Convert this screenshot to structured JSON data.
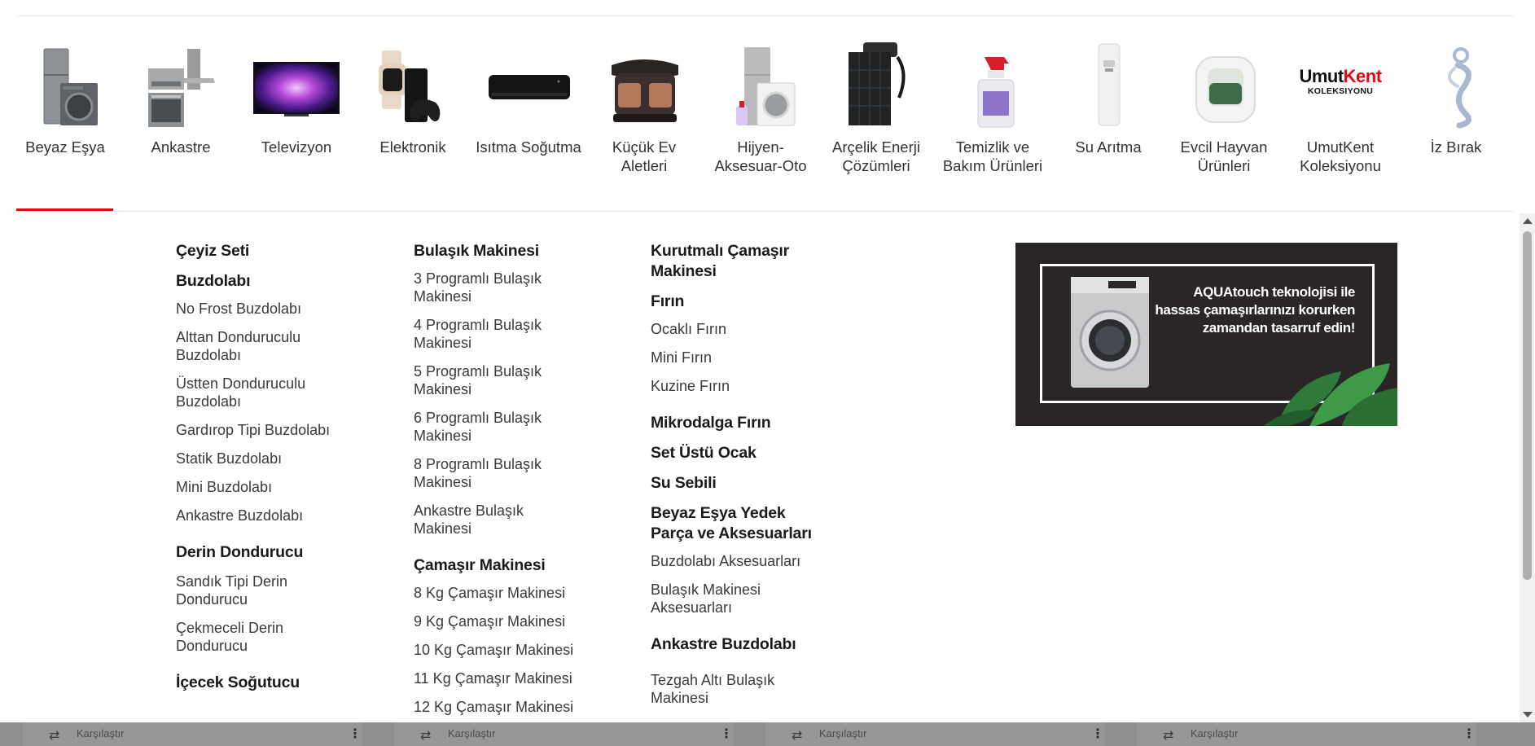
{
  "categories": [
    {
      "label": "Beyaz Eşya",
      "icon": "fridge-washer-icon"
    },
    {
      "label": "Ankastre",
      "icon": "built-in-oven-icon"
    },
    {
      "label": "Televizyon",
      "icon": "tv-icon"
    },
    {
      "label": "Elektronik",
      "icon": "watch-console-icon"
    },
    {
      "label": "Isıtma Soğutma",
      "icon": "air-conditioner-icon"
    },
    {
      "label": "Küçük Ev Aletleri",
      "icon": "coffee-machine-icon"
    },
    {
      "label": "Hijyen-Aksesuar-Oto",
      "icon": "hygiene-products-icon"
    },
    {
      "label": "Arçelik Enerji Çözümleri",
      "icon": "solar-panel-charger-icon"
    },
    {
      "label": "Temizlik ve Bakım Ürünleri",
      "icon": "spray-bottle-icon"
    },
    {
      "label": "Su Arıtma",
      "icon": "water-purifier-icon"
    },
    {
      "label": "Evcil Hayvan Ürünleri",
      "icon": "pet-litter-box-icon"
    },
    {
      "label": "UmutKent Koleksiyonu",
      "icon": "umutkent-logo"
    },
    {
      "label": "İz Bırak",
      "icon": "iz-birak-logo"
    }
  ],
  "umutkent_logo": {
    "umut": "Umut",
    "kent": "Kent",
    "sub": "KOLEKSIYONU"
  },
  "menu": {
    "col1": {
      "h1": "Çeyiz Seti",
      "h2": "Buzdolabı",
      "buzdolabi": [
        "No Frost Buzdolabı",
        "Alttan Donduruculu Buzdolabı",
        "Üstten Donduruculu Buzdolabı",
        "Gardırop Tipi Buzdolabı",
        "Statik Buzdolabı",
        "Mini Buzdolabı",
        "Ankastre Buzdolabı"
      ],
      "h3": "Derin Dondurucu",
      "derin": [
        "Sandık Tipi Derin Dondurucu",
        "Çekmeceli Derin Dondurucu"
      ],
      "h4": "İçecek Soğutucu"
    },
    "col2": {
      "h1": "Bulaşık Makinesi",
      "bulasik": [
        "3 Programlı Bulaşık Makinesi",
        "4 Programlı Bulaşık Makinesi",
        "5 Programlı Bulaşık Makinesi",
        "6 Programlı Bulaşık Makinesi",
        "8 Programlı Bulaşık Makinesi",
        "Ankastre Bulaşık Makinesi"
      ],
      "h2": "Çamaşır Makinesi",
      "camasir": [
        "8 Kg Çamaşır Makinesi",
        "9 Kg Çamaşır Makinesi",
        "10 Kg Çamaşır Makinesi",
        "11 Kg Çamaşır Makinesi",
        "12 Kg Çamaşır Makinesi"
      ]
    },
    "col3": {
      "h1": "Kurutmalı Çamaşır Makinesi",
      "h2": "Fırın",
      "firin": [
        "Ocaklı Fırın",
        "Mini Fırın",
        "Kuzine Fırın"
      ],
      "h3": "Mikrodalga Fırın",
      "h4": "Set Üstü Ocak",
      "h5": "Su Sebili",
      "h6": "Beyaz Eşya Yedek Parça ve Aksesuarları",
      "aksesuar": [
        "Buzdolabı Aksesuarları",
        "Bulaşık Makinesi Aksesuarları"
      ],
      "h7": "Ankastre Buzdolabı",
      "ankastre": [
        "Tezgah Altı Bulaşık Makinesi"
      ]
    }
  },
  "banner": {
    "line1": "AQUAtouch teknolojisi ile",
    "line2": "hassas çamaşırlarınızı korurken",
    "line3": "zamandan tasarruf edin!"
  },
  "bottom_bar": {
    "label": "Karşılaştır"
  },
  "colors": {
    "accent": "#e30613",
    "banner_bg": "#2a2627"
  }
}
